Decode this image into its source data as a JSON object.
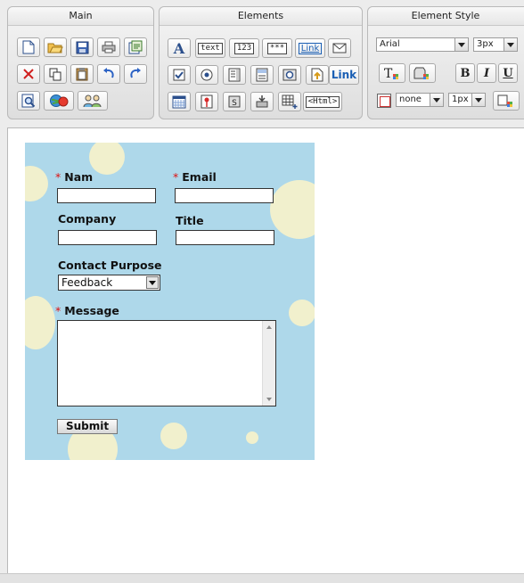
{
  "toolbar": {
    "main": {
      "title": "Main",
      "icons": [
        "new-document-icon",
        "open-folder-icon",
        "save-icon",
        "print-icon",
        "export-icon",
        "delete-icon",
        "copy-icon",
        "paste-icon",
        "undo-icon",
        "redo-icon",
        "preview-icon",
        "publish-icon",
        "users-icon"
      ]
    },
    "elements": {
      "title": "Elements",
      "text_label": "text",
      "number_label": "123",
      "password_label": "***",
      "link_small_label": "Link",
      "link_label": "Link",
      "html_label": "<Html>"
    },
    "style": {
      "title": "Element Style",
      "font_value": "Arial",
      "size_value": "3px",
      "border_style_value": "none",
      "border_width_value": "1px",
      "bold_label": "B",
      "italic_label": "I",
      "underline_label": "U"
    }
  },
  "form": {
    "name_label": "Nam",
    "email_label": "Email",
    "company_label": "Company",
    "title_label": "Title",
    "purpose_label": "Contact Purpose",
    "purpose_value": "Feedback",
    "message_label": "Message",
    "submit_label": "Submit",
    "required_mark": "*"
  },
  "colors": {
    "form_background": "#aed8ea",
    "bubble": "#f1f0cd",
    "required": "#dd1111"
  }
}
